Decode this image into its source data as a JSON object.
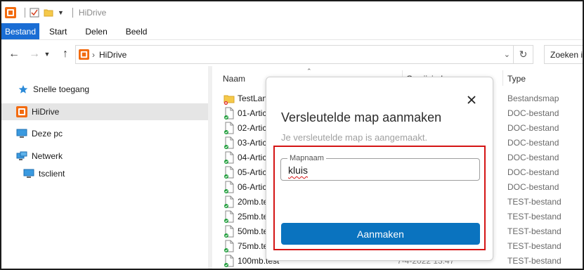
{
  "titlebar": {
    "title": "HiDrive"
  },
  "ribbon": {
    "tabs": [
      {
        "label": "Bestand"
      },
      {
        "label": "Start"
      },
      {
        "label": "Delen"
      },
      {
        "label": "Beeld"
      }
    ]
  },
  "address": {
    "path": "HiDrive",
    "search_placeholder": "Zoeken in"
  },
  "navpane": {
    "items": [
      {
        "label": "Snelle toegang",
        "icon": "star-icon"
      },
      {
        "label": "HiDrive",
        "icon": "hidrive-icon",
        "selected": true
      },
      {
        "label": "Deze pc",
        "icon": "computer-icon"
      },
      {
        "label": "Netwerk",
        "icon": "network-icon"
      },
      {
        "label": "tsclient",
        "icon": "monitor-icon"
      }
    ]
  },
  "filelist": {
    "columns": {
      "name": "Naam",
      "date": "Gewijzigd op",
      "type": "Type"
    },
    "rows": [
      {
        "name": "TestLan",
        "type": "Bestandsmap",
        "kind": "folder"
      },
      {
        "name": "01-Artic",
        "type": "DOC-bestand",
        "kind": "file"
      },
      {
        "name": "02-Artic",
        "type": "DOC-bestand",
        "kind": "file"
      },
      {
        "name": "03-Artic",
        "type": "DOC-bestand",
        "kind": "file"
      },
      {
        "name": "04-Artic",
        "type": "DOC-bestand",
        "kind": "file"
      },
      {
        "name": "05-Artic",
        "type": "DOC-bestand",
        "kind": "file"
      },
      {
        "name": "06-Artic",
        "type": "DOC-bestand",
        "kind": "file"
      },
      {
        "name": "20mb.te",
        "type": "TEST-bestand",
        "kind": "file"
      },
      {
        "name": "25mb.te",
        "type": "TEST-bestand",
        "kind": "file"
      },
      {
        "name": "50mb.te",
        "type": "TEST-bestand",
        "kind": "file"
      },
      {
        "name": "75mb.te",
        "type": "TEST-bestand",
        "kind": "file"
      },
      {
        "name": "100mb.test",
        "date": "7-4-2022 13:47",
        "type": "TEST-bestand",
        "kind": "file"
      }
    ]
  },
  "dialog": {
    "title": "Versleutelde map aanmaken",
    "subtitle": "Je versleutelde map is aangemaakt.",
    "field_label": "Mapnaam",
    "field_value": "kluis",
    "submit_label": "Aanmaken"
  },
  "colors": {
    "accent": "#0a73bf",
    "ribbon_file_tab": "#1a6dd4",
    "highlight_border": "#d41414",
    "selected_nav": "#e5e5e5"
  }
}
